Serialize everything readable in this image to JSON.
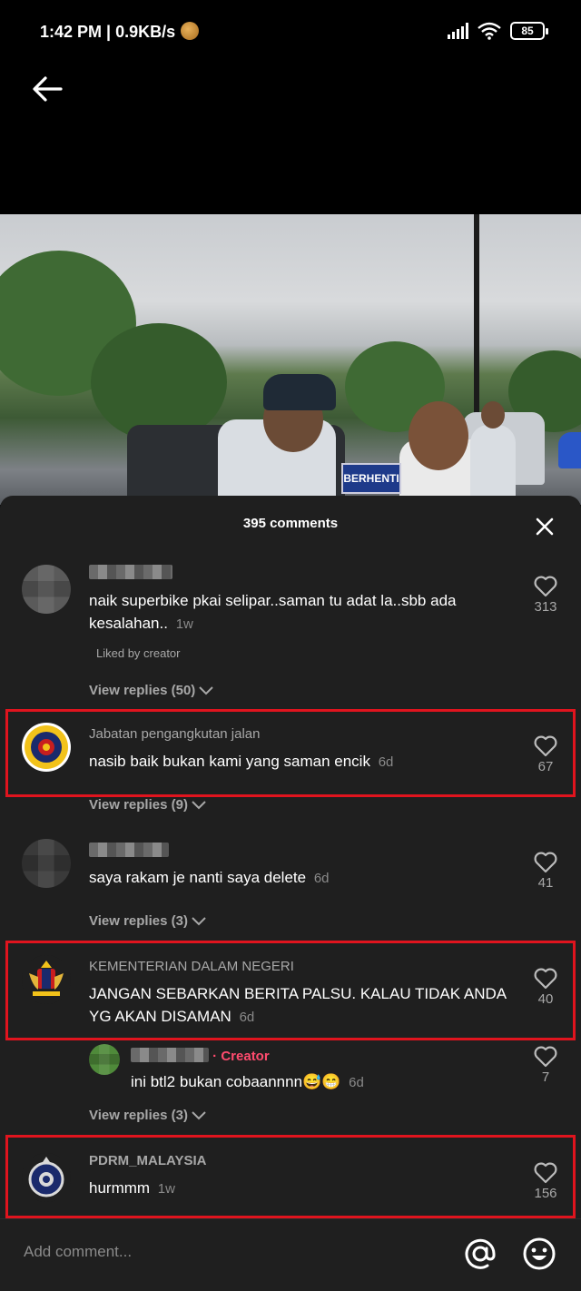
{
  "status_bar": {
    "time": "1:42 PM | 0.9KB/s",
    "battery": "85"
  },
  "icons": {
    "back": "arrow-left-icon",
    "close": "close-icon",
    "like": "heart-outline-icon",
    "chevron": "chevron-down-icon",
    "mention": "at-icon",
    "emoji": "emoji-icon"
  },
  "video": {
    "sign_text": "BERHENTI"
  },
  "comments_sheet": {
    "title": "395 comments",
    "comments": [
      {
        "username": "",
        "text": "naik superbike pkai selipar..saman tu adat la..sbb ada kesalahan..",
        "time": "1w",
        "liked_by_creator": "Liked by creator",
        "likes": "313",
        "view_replies": "View replies (50)"
      },
      {
        "username": "Jabatan pengangkutan jalan",
        "text": "nasib baik bukan kami yang saman encik",
        "time": "6d",
        "likes": "67",
        "view_replies": "View replies (9)"
      },
      {
        "username": "",
        "text": "saya rakam je nanti saya delete",
        "time": "6d",
        "likes": "41",
        "view_replies": "View replies (3)"
      },
      {
        "username": "KEMENTERIAN DALAM NEGERI",
        "text": "JANGAN SEBARKAN BERITA PALSU. KALAU TIDAK ANDA YG AKAN DISAMAN",
        "time": "6d",
        "likes": "40"
      },
      {
        "username": "",
        "creator_label": "· Creator",
        "text": "ini btl2 bukan cobaannnn😅😁",
        "time": "6d",
        "likes": "7",
        "view_replies": "View replies (3)"
      },
      {
        "username": "PDRM_MALAYSIA",
        "text": "hurmmm",
        "time": "1w",
        "likes": "156"
      }
    ]
  },
  "add_comment": {
    "placeholder": "Add comment..."
  },
  "colors": {
    "highlight": "#e0141e",
    "creator": "#ff4b6e",
    "sheet_bg": "#1f1f1f"
  }
}
